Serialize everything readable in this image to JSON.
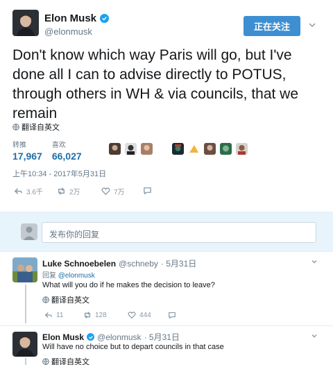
{
  "tweet": {
    "author_name": "Elon Musk",
    "author_handle": "@elonmusk",
    "follow_label": "正在关注",
    "text": "Don't know which way Paris will go, but I've done all I can to advise directly to POTUS, through others in WH & via councils, that we remain",
    "translate_label": "翻译自英文",
    "stats": [
      {
        "label": "转推",
        "value": "17,967"
      },
      {
        "label": "喜欢",
        "value": "66,027"
      }
    ],
    "timestamp": "上午10:34 - 2017年5月31日",
    "actions": {
      "reply_count": "3.6千",
      "retweet_count": "2万",
      "like_count": "7万"
    }
  },
  "reply_composer": {
    "placeholder": "发布你的回复"
  },
  "comments": [
    {
      "name": "Luke Schnoebelen",
      "handle": "@schneby",
      "date": "· 5月31日",
      "reply_prefix": "回复",
      "reply_to": "@elonmusk",
      "text": "What will you do if he makes the decision to leave?",
      "translate_label": "翻译自英文",
      "reply_count": "11",
      "retweet_count": "128",
      "like_count": "444"
    },
    {
      "name": "Elon Musk",
      "handle": "@elonmusk",
      "date": "· 5月31日",
      "text": "Will have no choice but to depart councils in that case",
      "translate_label": "翻译自英文"
    }
  ],
  "colors": {
    "accent": "#1da1f2",
    "follow_button": "#3d8fd1",
    "stat_value": "#1b6ea8",
    "reply_band": "#e8f4fb"
  },
  "icons": [
    "verified-icon",
    "chevron-down-icon",
    "globe-icon",
    "reply-icon",
    "retweet-icon",
    "like-icon",
    "message-icon"
  ]
}
